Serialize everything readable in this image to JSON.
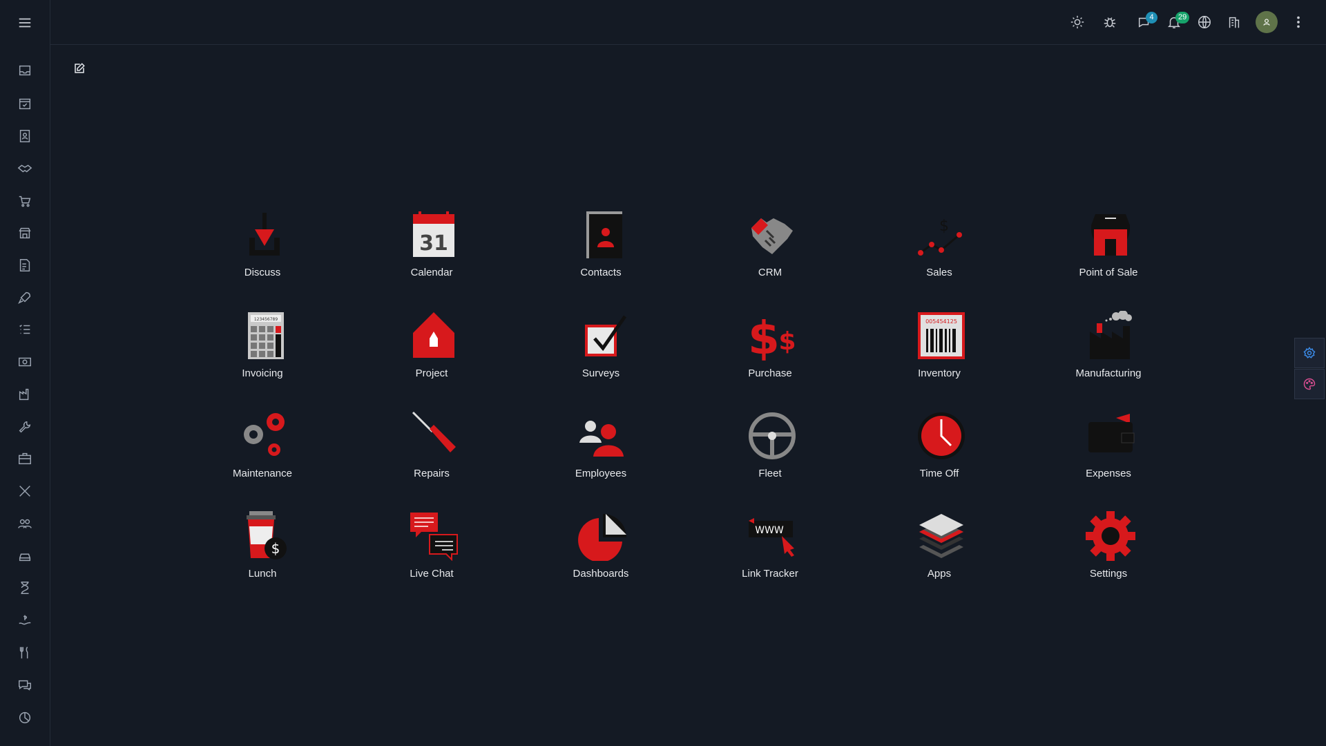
{
  "sidebar": {
    "items": [
      {
        "name": "menu-icon"
      },
      {
        "name": "inbox-icon"
      },
      {
        "name": "calendar-check-icon"
      },
      {
        "name": "contact-card-icon"
      },
      {
        "name": "handshake-icon"
      },
      {
        "name": "cart-icon"
      },
      {
        "name": "store-icon"
      },
      {
        "name": "invoice-icon"
      },
      {
        "name": "rocket-icon"
      },
      {
        "name": "list-check-icon"
      },
      {
        "name": "money-icon"
      },
      {
        "name": "factory-icon"
      },
      {
        "name": "wrench-icon"
      },
      {
        "name": "briefcase-icon"
      },
      {
        "name": "tools-icon"
      },
      {
        "name": "people-icon"
      },
      {
        "name": "car-icon"
      },
      {
        "name": "hourglass-icon"
      },
      {
        "name": "hand-dollar-icon"
      },
      {
        "name": "utensils-icon"
      },
      {
        "name": "chat-icon"
      },
      {
        "name": "pie-chart-icon"
      }
    ]
  },
  "topbar": {
    "chat_badge": "4",
    "notifications_badge": "29",
    "icons": [
      "sun-icon",
      "bug-icon",
      "chat-bubble-icon",
      "bell-icon",
      "globe-icon",
      "building-icon",
      "user-avatar",
      "more-vertical-icon"
    ]
  },
  "apps": [
    {
      "label": "Discuss",
      "icon": "discuss-icon"
    },
    {
      "label": "Calendar",
      "icon": "calendar-icon",
      "day": "31"
    },
    {
      "label": "Contacts",
      "icon": "contacts-icon"
    },
    {
      "label": "CRM",
      "icon": "crm-icon"
    },
    {
      "label": "Sales",
      "icon": "sales-icon"
    },
    {
      "label": "Point of Sale",
      "icon": "pos-icon"
    },
    {
      "label": "Invoicing",
      "icon": "invoicing-icon",
      "screen": "123456789"
    },
    {
      "label": "Project",
      "icon": "project-icon"
    },
    {
      "label": "Surveys",
      "icon": "surveys-icon"
    },
    {
      "label": "Purchase",
      "icon": "purchase-icon"
    },
    {
      "label": "Inventory",
      "icon": "inventory-icon",
      "code": "005454125"
    },
    {
      "label": "Manufacturing",
      "icon": "manufacturing-icon"
    },
    {
      "label": "Maintenance",
      "icon": "maintenance-icon"
    },
    {
      "label": "Repairs",
      "icon": "repairs-icon"
    },
    {
      "label": "Employees",
      "icon": "employees-icon"
    },
    {
      "label": "Fleet",
      "icon": "fleet-icon"
    },
    {
      "label": "Time Off",
      "icon": "time-off-icon"
    },
    {
      "label": "Expenses",
      "icon": "expenses-icon"
    },
    {
      "label": "Lunch",
      "icon": "lunch-icon"
    },
    {
      "label": "Live Chat",
      "icon": "live-chat-icon"
    },
    {
      "label": "Dashboards",
      "icon": "dashboards-icon"
    },
    {
      "label": "Link Tracker",
      "icon": "link-tracker-icon",
      "www": "WWW"
    },
    {
      "label": "Apps",
      "icon": "apps-icon"
    },
    {
      "label": "Settings",
      "icon": "settings-icon"
    }
  ],
  "colors": {
    "background": "#141a24",
    "accent": "#d7191c",
    "icon_dark": "#111111",
    "badge_chat": "#1f8fb5",
    "badge_notif": "#17a36b"
  }
}
